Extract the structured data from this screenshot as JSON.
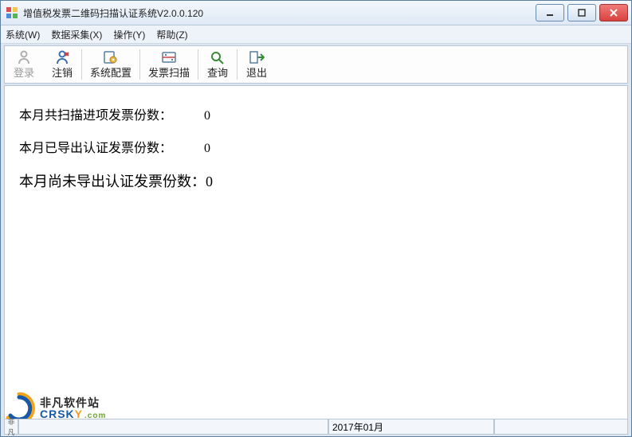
{
  "title": "增值税发票二维码扫描认证系统V2.0.0.120",
  "menu": {
    "system": "系统(W)",
    "collect": "数据采集(X)",
    "operate": "操作(Y)",
    "help": "帮助(Z)"
  },
  "toolbar": {
    "login": "登录",
    "logout": "注销",
    "config": "系统配置",
    "scan": "发票扫描",
    "query": "查询",
    "exit": "退出"
  },
  "stats": {
    "scanned_label": "本月共扫描进项发票份数：",
    "scanned_value": "0",
    "exported_label": "本月已导出认证发票份数：",
    "exported_value": "0",
    "pending_label": "本月尚未导出认证发票份数：",
    "pending_value": "0"
  },
  "statusbar": {
    "grip": "非凡",
    "period": "2017年01月"
  },
  "watermark": {
    "brand_cn": "非凡软件站",
    "brand_en_a": "CRSK",
    "brand_en_b": "Y",
    "brand_en_c": ".com"
  }
}
